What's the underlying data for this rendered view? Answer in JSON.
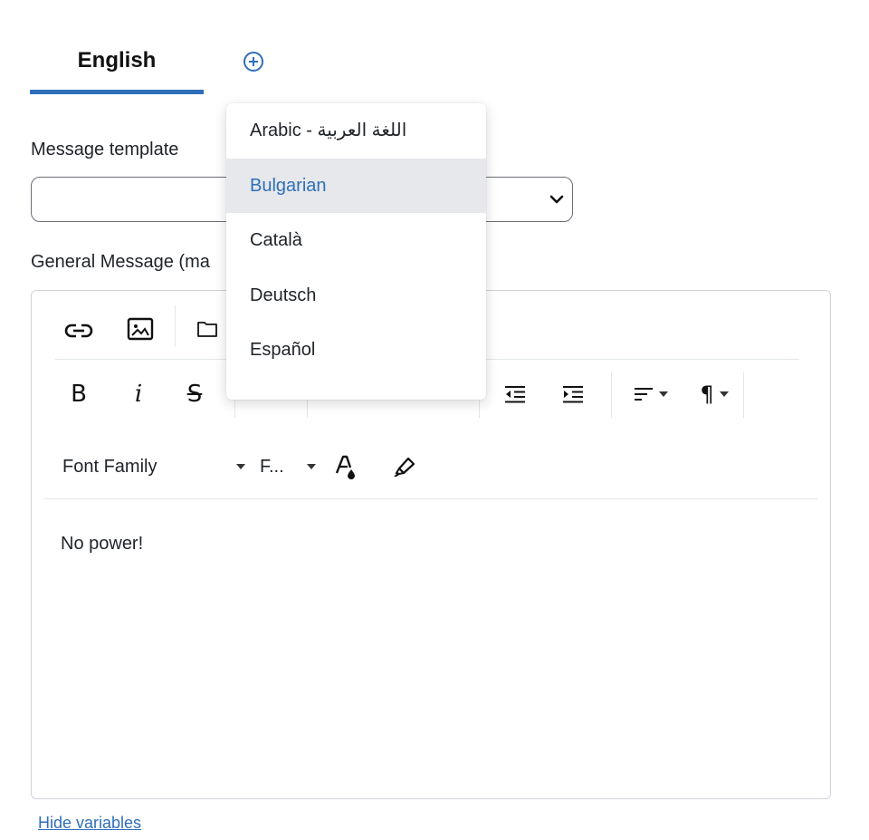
{
  "tabs": {
    "active_label": "English",
    "add_icon": "plus-circle-icon"
  },
  "form": {
    "template_label": "Message template",
    "template_value": "",
    "general_label": "General Message (ma"
  },
  "editor": {
    "toolbar_row1": [
      "link-icon",
      "image-icon",
      "folder-icon"
    ],
    "toolbar_row2": {
      "bold": "B",
      "italic": "i",
      "strike": "S",
      "pilcrow": "¶"
    },
    "font_family": "Font Family",
    "font_size": "F...",
    "content": "No power!"
  },
  "dropdown": {
    "items": [
      {
        "label": "Arabic - اللغة العربية"
      },
      {
        "label": "Bulgarian"
      },
      {
        "label": "Català"
      },
      {
        "label": "Deutsch"
      },
      {
        "label": "Español"
      }
    ],
    "active_index": 1
  },
  "footer": {
    "hide_variables": "Hide variables"
  },
  "colors": {
    "accent": "#2f6fba",
    "active_bg": "#e6e8eb"
  }
}
